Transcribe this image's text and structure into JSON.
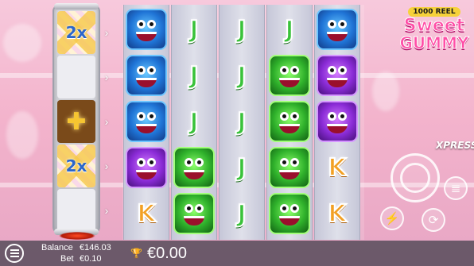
{
  "logo": {
    "top": "1000 REEL",
    "line1": "Sweet",
    "line2": "GUMMY"
  },
  "side_column": {
    "cells": [
      {
        "type": "mult",
        "text": "2x"
      },
      {
        "type": "empty",
        "text": ""
      },
      {
        "type": "bonus",
        "text": ""
      },
      {
        "type": "mult",
        "text": "2x"
      },
      {
        "type": "empty",
        "text": ""
      }
    ],
    "arrow_icon": "chevron-right-icon"
  },
  "reels": [
    [
      "blue-monster",
      "blue-monster",
      "blue-monster",
      "purple-monster",
      "K"
    ],
    [
      "J",
      "J",
      "J",
      "green-monster",
      "green-monster"
    ],
    [
      "J",
      "J",
      "J",
      "J",
      "J"
    ],
    [
      "J",
      "green-monster",
      "green-monster",
      "green-monster",
      "green-monster"
    ],
    [
      "blue-monster",
      "purple-monster",
      "purple-monster",
      "K",
      "K"
    ]
  ],
  "controls": {
    "xpress_label": "XPRESS",
    "spin_icon": "spin-icon",
    "stack_icon": "coin-stack-icon",
    "turbo_icon": "lightning-icon",
    "autoplay_icon": "autoplay-icon"
  },
  "bottom_bar": {
    "balance_label": "Balance",
    "balance_value": "€146.03",
    "bet_label": "Bet",
    "bet_value": "€0.10",
    "win_value": "€0.00",
    "menu_icon": "menu-icon",
    "trophy_icon": "trophy-icon"
  },
  "colors": {
    "background": "#f3b3cc",
    "j_symbol": "#39c23a",
    "k_symbol": "#f2a024",
    "blue_tile": "#1f74d6",
    "green_tile": "#2fb12b",
    "purple_tile": "#8a2bd6"
  }
}
